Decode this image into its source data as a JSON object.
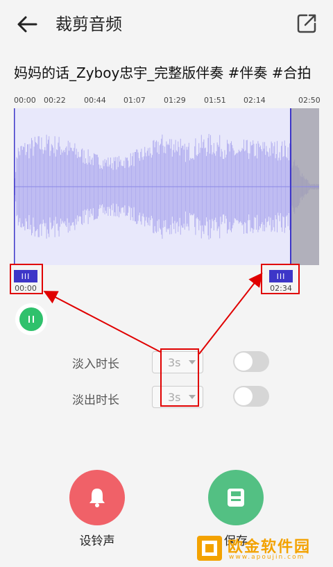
{
  "header": {
    "title": "裁剪音频"
  },
  "song": {
    "title": "妈妈的话_Zyboy忠宇_完整版伴奏 #伴奏 #合拍"
  },
  "timeline": {
    "ticks": [
      "00:00",
      "00:22",
      "00:44",
      "01:07",
      "01:29",
      "01:51",
      "02:14",
      "02:50"
    ]
  },
  "selection": {
    "start_label": "00:00",
    "end_label": "02:34",
    "handle_glyph": "III",
    "start_fraction": 0.0,
    "end_fraction": 0.906
  },
  "playback": {
    "state": "playing"
  },
  "fade": {
    "in": {
      "label": "淡入时长",
      "value": "3s",
      "enabled": false
    },
    "out": {
      "label": "淡出时长",
      "value": "3s",
      "enabled": false
    }
  },
  "actions": {
    "ringtone_label": "设铃声",
    "save_label": "保存"
  },
  "watermark": {
    "brand": "欧金软件园",
    "url": "www.apoujin.com"
  },
  "colors": {
    "selection": "#3d36c8",
    "waveform": "#b3b0ef",
    "play": "#2fc16c",
    "ringtone": "#f06168",
    "save": "#53c083",
    "annotation": "#e00000"
  }
}
